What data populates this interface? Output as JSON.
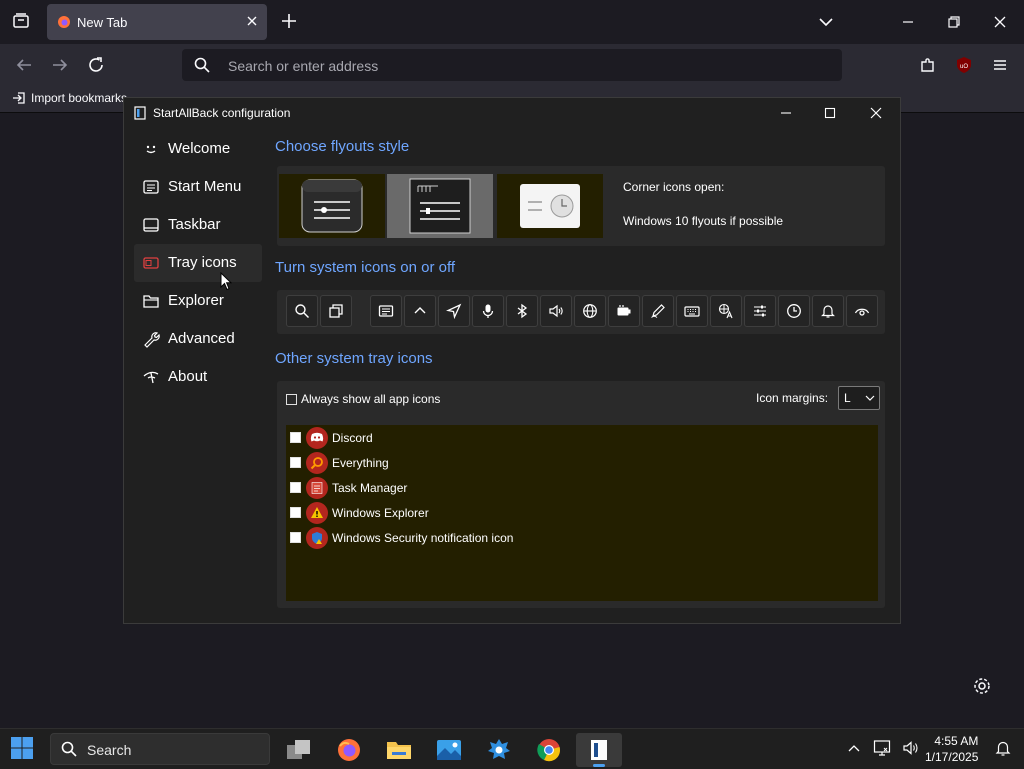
{
  "browser": {
    "tab_title": "New Tab",
    "address_placeholder": "Search or enter address",
    "bookmark_import_label": "Import bookmarks..."
  },
  "sab": {
    "window_title": "StartAllBack configuration",
    "nav": [
      {
        "label": "Welcome",
        "icon": "smiley-icon"
      },
      {
        "label": "Start Menu",
        "icon": "start-menu-icon"
      },
      {
        "label": "Taskbar",
        "icon": "taskbar-icon"
      },
      {
        "label": "Tray icons",
        "icon": "tray-icon",
        "active": true
      },
      {
        "label": "Explorer",
        "icon": "folder-icon"
      },
      {
        "label": "Advanced",
        "icon": "wrench-icon"
      },
      {
        "label": "About",
        "icon": "about-icon"
      }
    ],
    "flyouts": {
      "heading": "Choose flyouts style",
      "selected_index": 1,
      "corner_label": "Corner icons open:",
      "corner_value": "Windows 10 flyouts if possible"
    },
    "system_icons": {
      "heading": "Turn system icons on or off",
      "icons": [
        "search-icon",
        "task-view-icon",
        "news-icon",
        "chevron-up-icon",
        "location-icon",
        "microphone-icon",
        "bluetooth-icon",
        "volume-icon",
        "globe-icon",
        "battery-icon",
        "pen-icon",
        "keyboard-icon",
        "language-icon",
        "settings-sliders-icon",
        "clock-icon",
        "bell-icon",
        "eye-icon"
      ]
    },
    "other_tray": {
      "heading": "Other system tray icons",
      "always_show_label": "Always show all app icons",
      "always_show_checked": false,
      "icon_margins_label": "Icon margins:",
      "icon_margins_value": "L",
      "apps": [
        {
          "name": "Discord",
          "icon": "discord-icon",
          "checked": false
        },
        {
          "name": "Everything",
          "icon": "magnifier-icon",
          "checked": false
        },
        {
          "name": "Task Manager",
          "icon": "task-manager-icon",
          "checked": false
        },
        {
          "name": "Windows Explorer",
          "icon": "warning-icon",
          "checked": false
        },
        {
          "name": "Windows Security notification icon",
          "icon": "security-shield-icon",
          "checked": false
        }
      ]
    }
  },
  "taskbar": {
    "search_label": "Search",
    "time": "4:55 AM",
    "date": "1/17/2025"
  },
  "colors": {
    "accent_blue": "#6fa6ff",
    "panel_dark_olive": "#231f00",
    "taskbar_indicator": "#4ca0f0"
  }
}
